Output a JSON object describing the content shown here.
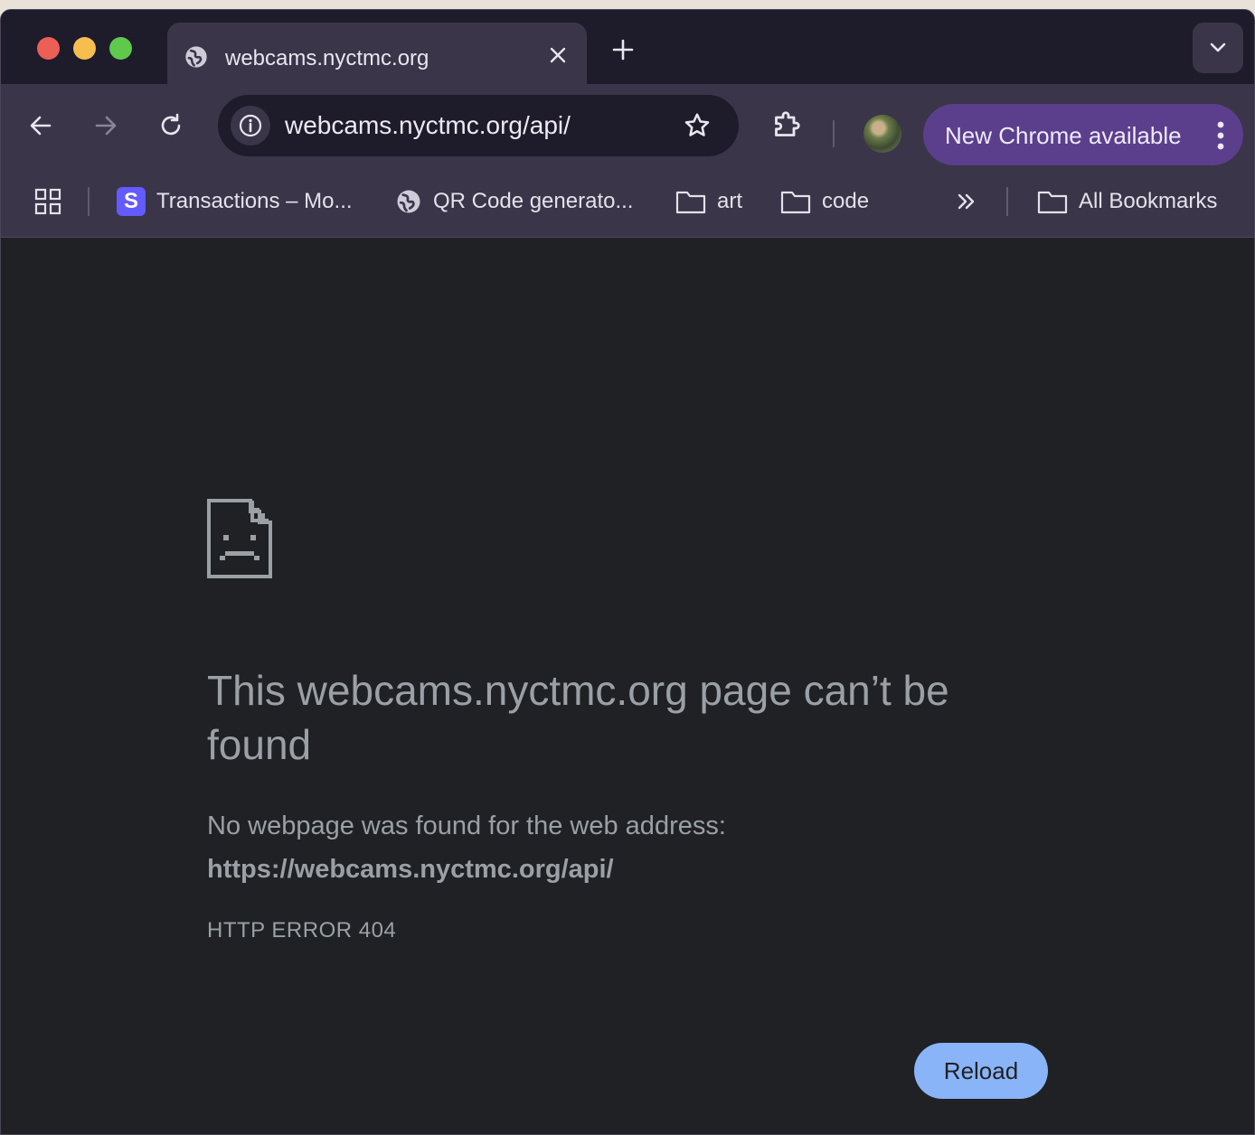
{
  "browser": {
    "tab": {
      "title": "webcams.nyctmc.org",
      "icon": "globe-icon"
    },
    "omnibox": {
      "url": "webcams.nyctmc.org/api/"
    },
    "update_button": {
      "label": "New Chrome available"
    },
    "bookmarks": [
      {
        "label": "Transactions – Mo...",
        "icon": "stripe-logo"
      },
      {
        "label": "QR Code generato...",
        "icon": "globe-icon"
      },
      {
        "label": "art",
        "icon": "folder-icon"
      },
      {
        "label": "code",
        "icon": "folder-icon"
      }
    ],
    "all_bookmarks": {
      "label": "All Bookmarks"
    }
  },
  "page": {
    "headline": "This webcams.nyctmc.org page can’t be found",
    "description": "No webpage was found for the web address:",
    "address": "https://webcams.nyctmc.org/api/",
    "error_code": "HTTP ERROR 404",
    "reload_label": "Reload"
  },
  "colors": {
    "tab_strip": "#1e1b2b",
    "toolbar": "#3a3549",
    "update_button": "#5b3f8c",
    "content_bg": "#202124",
    "text_muted": "#9aa0a6",
    "accent": "#8ab4f8"
  }
}
